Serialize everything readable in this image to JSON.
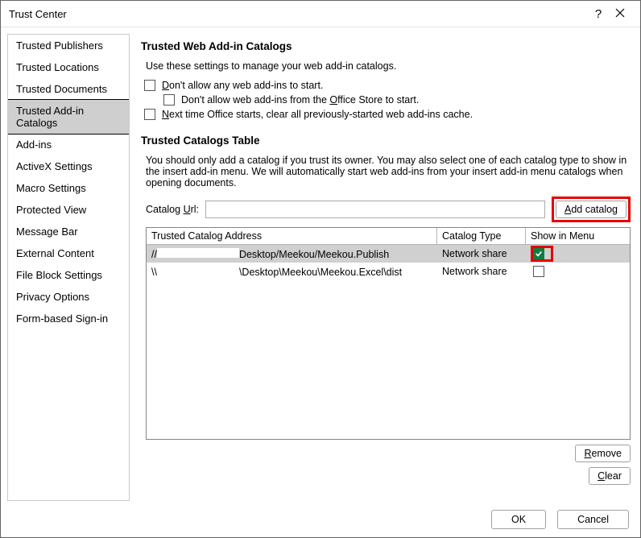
{
  "window": {
    "title": "Trust Center"
  },
  "sidebar": {
    "items": [
      {
        "label": "Trusted Publishers"
      },
      {
        "label": "Trusted Locations"
      },
      {
        "label": "Trusted Documents"
      },
      {
        "label": "Trusted Add-in Catalogs"
      },
      {
        "label": "Add-ins"
      },
      {
        "label": "ActiveX Settings"
      },
      {
        "label": "Macro Settings"
      },
      {
        "label": "Protected View"
      },
      {
        "label": "Message Bar"
      },
      {
        "label": "External Content"
      },
      {
        "label": "File Block Settings"
      },
      {
        "label": "Privacy Options"
      },
      {
        "label": "Form-based Sign-in"
      }
    ],
    "selected_index": 3
  },
  "section1": {
    "title": "Trusted Web Add-in Catalogs",
    "desc": "Use these settings to manage your web add-in catalogs.",
    "check1_pre": "D",
    "check1_rest": "on't allow any web add-ins to start.",
    "check2_pre": "Don't allow web add-ins from the ",
    "check2_u": "O",
    "check2_post": "ffice Store to start.",
    "check3_u": "N",
    "check3_rest": "ext time Office starts, clear all previously-started web add-ins cache."
  },
  "section2": {
    "title": "Trusted Catalogs Table",
    "desc": "You should only add a catalog if you trust its owner. You may also select one of each catalog type to show in the insert add-in menu. We will automatically start web add-ins from your insert add-in menu catalogs when opening documents.",
    "url_label_pre": "Catalog ",
    "url_label_u": "U",
    "url_label_post": "rl:",
    "url_value": "",
    "add_button_u": "A",
    "add_button_rest": "dd catalog",
    "columns": {
      "addr": "Trusted Catalog Address",
      "type": "Catalog Type",
      "menu": "Show in Menu"
    },
    "rows": [
      {
        "addr_prefix": "//",
        "addr_suffix": "Desktop/Meekou/Meekou.Publish",
        "type": "Network share",
        "checked": true
      },
      {
        "addr_prefix": "\\\\",
        "addr_suffix": "\\Desktop\\Meekou\\Meekou.Excel\\dist",
        "type": "Network share",
        "checked": false
      }
    ],
    "remove_u": "R",
    "remove_rest": "emove",
    "clear_u": "C",
    "clear_rest": "lear"
  },
  "footer": {
    "ok": "OK",
    "cancel": "Cancel"
  }
}
